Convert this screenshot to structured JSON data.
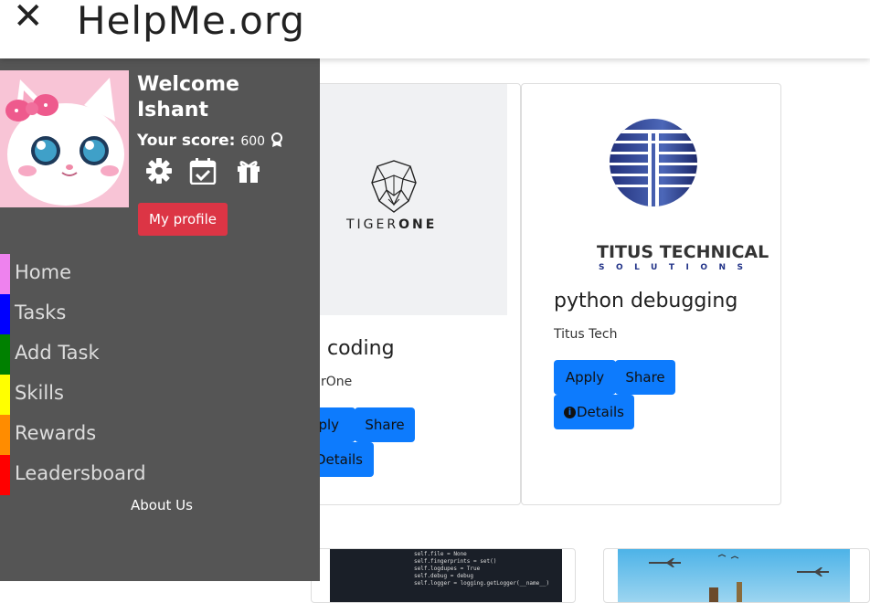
{
  "header": {
    "close_glyph": "✕",
    "brand": "HelpMe.org"
  },
  "sidebar": {
    "welcome": "Welcome Ishant",
    "score_label": "Your score:",
    "score_value": "600",
    "profile_button": "My profile",
    "nav": [
      {
        "label": "Home",
        "color": "#ee82ee"
      },
      {
        "label": "Tasks",
        "color": "#0000ff"
      },
      {
        "label": "Add Task",
        "color": "#008000"
      },
      {
        "label": "Skills",
        "color": "#ffff00"
      },
      {
        "label": "Rewards",
        "color": "#ff8c00"
      },
      {
        "label": "Leadersboard",
        "color": "#ff0000"
      }
    ],
    "about": "About Us"
  },
  "cards": [
    {
      "logo_word_light": "TIGER",
      "logo_word_bold": "ONE",
      "title": "coding",
      "org": "rOne",
      "apply": "pply",
      "share": "Share",
      "details": "Details"
    },
    {
      "logo_word": "TITUS TECHNICAL",
      "logo_sub": "SOLUTIONS",
      "title": "python debugging",
      "org": "Titus Tech",
      "apply": "Apply",
      "share": "Share",
      "details": "Details"
    }
  ],
  "colors": {
    "sidebar_bg": "#555555",
    "primary": "#0d7bfd",
    "danger": "#dc3545"
  }
}
